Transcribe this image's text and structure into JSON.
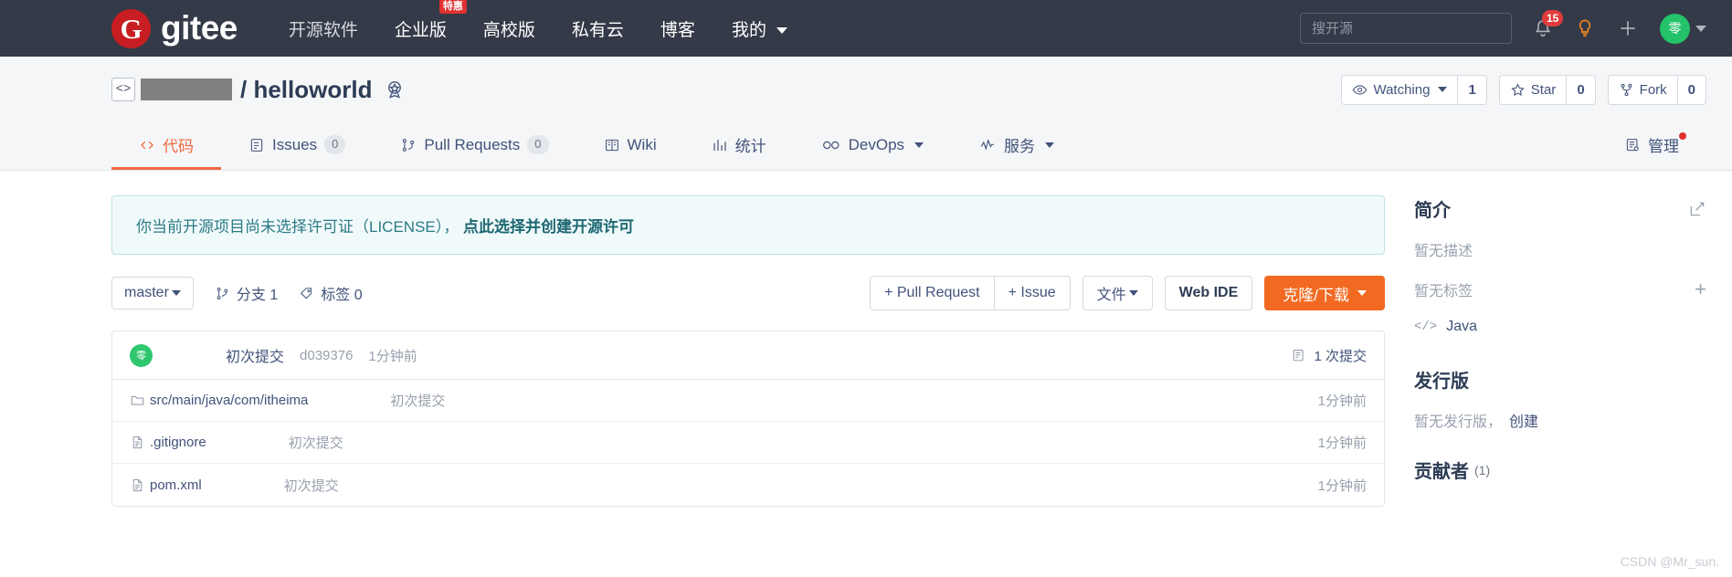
{
  "topnav": {
    "logo_letter": "G",
    "logo_text": "gitee",
    "links": [
      {
        "label": "开源软件",
        "badge": null
      },
      {
        "label": "企业版",
        "badge": "特惠"
      },
      {
        "label": "高校版",
        "badge": null
      },
      {
        "label": "私有云",
        "badge": null
      },
      {
        "label": "博客",
        "badge": null
      },
      {
        "label": "我的",
        "badge": null,
        "has_caret": true
      }
    ],
    "search_placeholder": "搜开源",
    "notification_count": "15",
    "icons": [
      "bell-icon",
      "lightbulb-icon",
      "plus-icon",
      "avatar"
    ],
    "avatar_letter": "零"
  },
  "repo": {
    "owner_redacted": true,
    "separator": "/",
    "name": "helloworld",
    "code_icon": "<>",
    "watch": {
      "label": "Watching",
      "count": "1"
    },
    "star": {
      "label": "Star",
      "count": "0"
    },
    "fork": {
      "label": "Fork",
      "count": "0"
    }
  },
  "tabs": [
    {
      "label": "代码",
      "icon": "code-icon",
      "count": null,
      "active": true
    },
    {
      "label": "Issues",
      "icon": "issue-icon",
      "count": "0",
      "active": false
    },
    {
      "label": "Pull Requests",
      "icon": "pr-icon",
      "count": "0",
      "active": false
    },
    {
      "label": "Wiki",
      "icon": "book-icon",
      "count": null,
      "active": false
    },
    {
      "label": "统计",
      "icon": "chart-icon",
      "count": null,
      "active": false
    },
    {
      "label": "DevOps",
      "icon": "infinity-icon",
      "count": null,
      "active": false,
      "caret": true
    },
    {
      "label": "服务",
      "icon": "pulse-icon",
      "count": null,
      "active": false,
      "caret": true
    },
    {
      "label": "管理",
      "icon": "manage-icon",
      "count": null,
      "active": false,
      "dot": true
    }
  ],
  "license_banner": {
    "text": "你当前开源项目尚未选择许可证（LICENSE）， ",
    "link": "点此选择并创建开源许可"
  },
  "toolbar": {
    "branch": "master",
    "branches_label": "分支 1",
    "tags_label": "标签 0",
    "pull_request_btn": "+ Pull Request",
    "issue_btn": "+ Issue",
    "files_btn": "文件",
    "web_ide_btn": "Web IDE",
    "clone_btn": "克隆/下载"
  },
  "commit_bar": {
    "avatar_letter": "零",
    "message": "初次提交",
    "sha": "d039376",
    "time": "1分钟前",
    "commit_count": "1 次提交"
  },
  "files": [
    {
      "name": "src/main/java/com/itheima",
      "type": "folder",
      "commit": "初次提交",
      "time": "1分钟前"
    },
    {
      "name": ".gitignore",
      "type": "file",
      "commit": "初次提交",
      "time": "1分钟前"
    },
    {
      "name": "pom.xml",
      "type": "file",
      "commit": "初次提交",
      "time": "1分钟前"
    }
  ],
  "sidebar": {
    "intro_title": "简介",
    "no_description": "暂无描述",
    "no_tags": "暂无标签",
    "language": "Java",
    "releases_title": "发行版",
    "no_releases": "暂无发行版，",
    "create_link": "创建",
    "contributors_title": "贡献者",
    "contributors_count": "(1)"
  },
  "watermark": "CSDN @Mr_sun.",
  "colors": {
    "nav_bg": "#343a47",
    "accent_orange": "#f26a21",
    "active_tab": "#f1683e",
    "logo_red": "#c71d23",
    "avatar_green": "#24c26a",
    "banner_border": "#bfe0e4",
    "text_dark": "#2d3c55"
  }
}
